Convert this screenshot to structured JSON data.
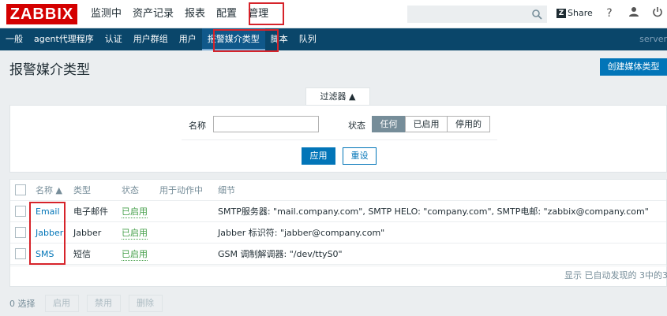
{
  "logo": "ZABBIX",
  "main_nav": [
    {
      "label": "监测中"
    },
    {
      "label": "资产记录"
    },
    {
      "label": "报表"
    },
    {
      "label": "配置"
    },
    {
      "label": "管理"
    }
  ],
  "search": {
    "value": "",
    "placeholder": ""
  },
  "share_label": "Share",
  "help_label": "?",
  "sub_nav": [
    {
      "label": "一般"
    },
    {
      "label": "agent代理程序"
    },
    {
      "label": "认证"
    },
    {
      "label": "用户群组"
    },
    {
      "label": "用户"
    },
    {
      "label": "报警媒介类型"
    },
    {
      "label": "脚本"
    },
    {
      "label": "队列"
    }
  ],
  "server_label": "server",
  "page_title": "报警媒介类型",
  "create_button": "创建媒体类型",
  "filter": {
    "tab_label": "过滤器 ▲",
    "name_label": "名称",
    "name_value": "",
    "status_label": "状态",
    "status_options": [
      "任何",
      "已启用",
      "停用的"
    ],
    "selected_status": "任何",
    "apply_label": "应用",
    "reset_label": "重设"
  },
  "table": {
    "columns": [
      "名称 ▲",
      "类型",
      "状态",
      "用于动作中",
      "细节"
    ],
    "rows": [
      {
        "name": "Email",
        "type": "电子邮件",
        "status": "已启用",
        "used_in": "",
        "details": "SMTP服务器: \"mail.company.com\", SMTP HELO: \"company.com\", SMTP电邮: \"zabbix@company.com\""
      },
      {
        "name": "Jabber",
        "type": "Jabber",
        "status": "已启用",
        "used_in": "",
        "details": "Jabber 标识符: \"jabber@company.com\""
      },
      {
        "name": "SMS",
        "type": "短信",
        "status": "已启用",
        "used_in": "",
        "details": "GSM 调制解调器: \"/dev/ttyS0\""
      }
    ],
    "footer_text": "显示 已自动发现的 3中的3"
  },
  "bottom": {
    "selected_text": "0 选择",
    "buttons": [
      "启用",
      "禁用",
      "删除"
    ]
  },
  "colors": {
    "logo_red": "#d40000",
    "nav_dark": "#0a466a",
    "accent_blue": "#0275b8",
    "enabled_green": "#429e47",
    "highlight_red": "#d6232a"
  }
}
